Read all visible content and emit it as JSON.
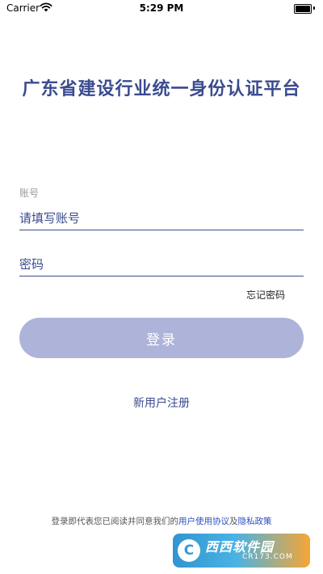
{
  "status_bar": {
    "carrier": "Carrier",
    "time": "5:29 PM",
    "battery_level": 1.0,
    "icons": [
      "wifi-icon",
      "battery-icon"
    ]
  },
  "header": {
    "title": "广东省建设行业统一身份认证平台"
  },
  "form": {
    "account_caption": "账号",
    "account_placeholder": "请填写账号",
    "password_placeholder": "密码",
    "forgot_label": "忘记密码",
    "login_label": "登录"
  },
  "register": {
    "label": "新用户注册"
  },
  "agreement": {
    "prefix": "登录即代表您已阅读并同意我们的",
    "user_agreement": "用户使用协议",
    "conjunction": "及",
    "privacy_policy": "隐私政策"
  },
  "watermark": {
    "brand": "西西软件园",
    "url": "CR173.COM"
  },
  "colors": {
    "accent": "#3b4b8f",
    "button": "#aeb3da",
    "link": "#2d4fc0"
  }
}
